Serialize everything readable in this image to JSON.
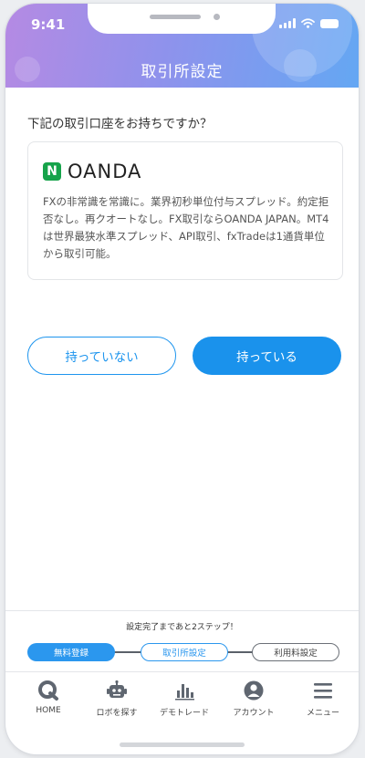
{
  "status_bar": {
    "time": "9:41"
  },
  "header": {
    "title": "取引所設定"
  },
  "main": {
    "question": "下記の取引口座をお持ちですか？",
    "card": {
      "logo": {
        "mark": "N",
        "text": "OANDA"
      },
      "description": "FXの非常識を常識に。業界初秒単位付与スプレッド。約定拒否なし。再クオートなし。FX取引ならOANDA JAPAN。MT4は世界最狭水準スプレッド、API取引、fxTradeは1通貨単位から取引可能。"
    },
    "buttons": {
      "no": "持っていない",
      "yes": "持っている"
    }
  },
  "steps": {
    "caption": "設定完了まであと2ステップ！",
    "items": [
      "無料登録",
      "取引所設定",
      "利用料設定"
    ]
  },
  "tabbar": {
    "items": [
      {
        "label": "HOME",
        "icon": "home-icon"
      },
      {
        "label": "ロボを探す",
        "icon": "robot-icon"
      },
      {
        "label": "デモトレード",
        "icon": "chart-icon"
      },
      {
        "label": "アカウント",
        "icon": "account-icon"
      },
      {
        "label": "メニュー",
        "icon": "menu-icon"
      }
    ]
  },
  "colors": {
    "accent": "#1a92ec",
    "header_gradient": [
      "#b58ae3",
      "#64a7f3"
    ],
    "oanda_green": "#16a34a"
  }
}
